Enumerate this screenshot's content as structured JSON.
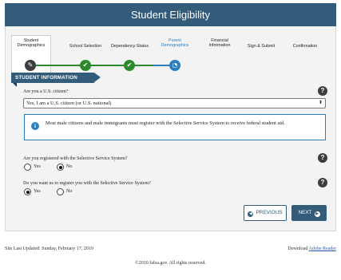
{
  "page": {
    "title": "Student Eligibility"
  },
  "steps": [
    {
      "label": "Student Demographics",
      "state": "current"
    },
    {
      "label": "School Selection",
      "state": "complete"
    },
    {
      "label": "Dependency Status",
      "state": "complete"
    },
    {
      "label": "Parent Demographics",
      "state": "in-progress"
    },
    {
      "label": "Financial Information",
      "state": "pending"
    },
    {
      "label": "Sign & Submit",
      "state": "pending"
    },
    {
      "label": "Confirmation",
      "state": "pending"
    }
  ],
  "section": {
    "title": "STUDENT INFORMATION"
  },
  "citizenship": {
    "question": "Are you a U.S. citizen?",
    "selected": "Yes, I am a U.S. citizen (or U.S. national)"
  },
  "info_notice": "Most male citizens and male immigrants must register with the Selective Service System to receive federal student aid.",
  "registered": {
    "question": "Are you registered with the Selective Service System?",
    "options": [
      "Yes",
      "No"
    ],
    "selected": "No"
  },
  "register_us": {
    "question": "Do you want us to register you with the Selective Service System?",
    "options": [
      "Yes",
      "No"
    ],
    "selected": "Yes"
  },
  "buttons": {
    "previous": "PREVIOUS",
    "next": "NEXT"
  },
  "footer": {
    "updated": "Site Last Updated: Sunday, February 17, 2019",
    "download_prefix": "Download",
    "download_link": "Adobe Reader",
    "copyright": "©2010 fafsa.gov. All rights reserved."
  },
  "colors": {
    "header": "#325c7a",
    "complete": "#2c8a2c",
    "active": "#2a7fc0"
  }
}
